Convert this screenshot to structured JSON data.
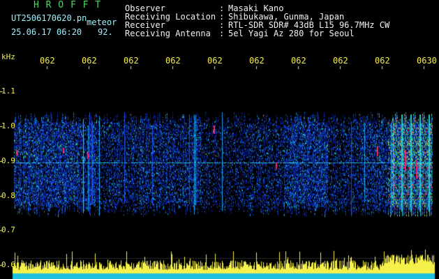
{
  "header": {
    "title": "H R O F F T",
    "filename": "UT2506170620.pn",
    "event_label": "meteor",
    "datetime": "25.06.17 06:20",
    "count": "92.",
    "fields": [
      {
        "label": "Observer",
        "value": "Masaki Kano"
      },
      {
        "label": "Receiving Location",
        "value": "Shibukawa, Gunma, Japan"
      },
      {
        "label": "Receiver",
        "value": "RTL-SDR SDR# 43dB L15 96.7MHz CW"
      },
      {
        "label": "Receiving Antenna",
        "value": "5el Yagi Az 280 for Seoul"
      }
    ],
    "separator": ":"
  },
  "axis": {
    "unit": "kHz",
    "y_ticks": [
      "1.1",
      "1.0",
      "0.9",
      "0.8",
      "0.7",
      "0.6"
    ],
    "x_ticks": [
      "062",
      "062",
      "062",
      "062",
      "062",
      "062",
      "062",
      "062",
      "062",
      "0630"
    ]
  },
  "colors": {
    "title": "#3de05a",
    "label_text": "#f2f2f2",
    "axis_text": "#f5f04a",
    "background": "#000000",
    "signal_low": "#1030c0",
    "signal_mid": "#20c0e0",
    "signal_high": "#ff2060",
    "histogram": "#f5f04a"
  }
}
